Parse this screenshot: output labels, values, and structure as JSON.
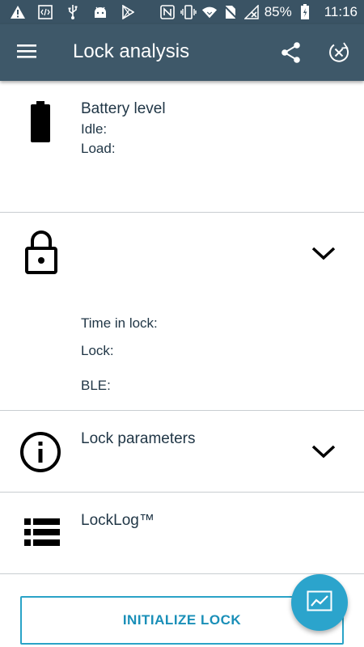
{
  "status_bar": {
    "battery_percent": "85%",
    "time": "11:16",
    "left_icons": [
      "warning-icon",
      "code-icon",
      "usb-icon",
      "android-icon",
      "play-store-icon"
    ],
    "right_icons": [
      "nfc-icon",
      "vibrate-icon",
      "wifi-icon",
      "no-sim-icon",
      "signal-off-icon",
      "battery-charging-icon"
    ]
  },
  "app_bar": {
    "title": "Lock analysis",
    "menu_icon": "hamburger-menu-icon",
    "share_icon": "share-icon",
    "close_icon": "close-circle-icon",
    "background": "#3e5869"
  },
  "battery_section": {
    "heading": "Battery level",
    "idle_label": "Idle:",
    "load_label": "Load:",
    "icon": "battery-icon"
  },
  "lock_section": {
    "icon": "padlock-icon",
    "time_in_lock_label": "Time in lock:",
    "lock_label": "Lock:",
    "ble_label": "BLE:",
    "expand_icon": "chevron-down-icon"
  },
  "params_section": {
    "heading": "Lock parameters",
    "icon": "info-icon",
    "expand_icon": "chevron-down-icon"
  },
  "log_section": {
    "heading": "LockLog™",
    "icon": "list-icon"
  },
  "actions": {
    "initialize_label": "INITIALIZE LOCK",
    "fab_icon": "chart-icon",
    "accent": "#2ba4cc"
  }
}
